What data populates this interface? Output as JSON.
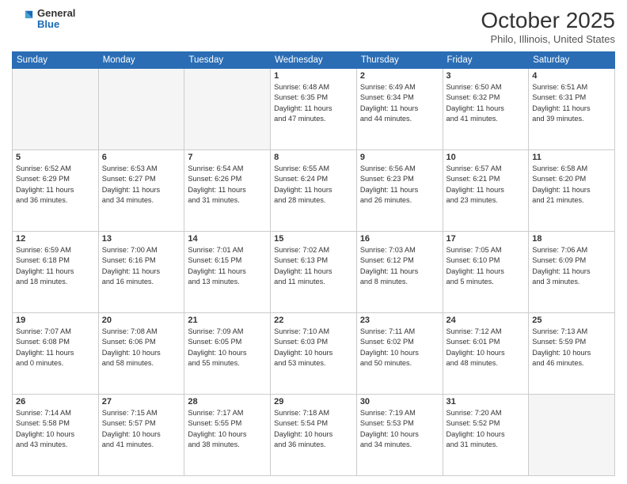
{
  "logo": {
    "general": "General",
    "blue": "Blue"
  },
  "header": {
    "month": "October 2025",
    "location": "Philo, Illinois, United States"
  },
  "weekdays": [
    "Sunday",
    "Monday",
    "Tuesday",
    "Wednesday",
    "Thursday",
    "Friday",
    "Saturday"
  ],
  "weeks": [
    [
      {
        "day": "",
        "info": ""
      },
      {
        "day": "",
        "info": ""
      },
      {
        "day": "",
        "info": ""
      },
      {
        "day": "1",
        "info": "Sunrise: 6:48 AM\nSunset: 6:35 PM\nDaylight: 11 hours\nand 47 minutes."
      },
      {
        "day": "2",
        "info": "Sunrise: 6:49 AM\nSunset: 6:34 PM\nDaylight: 11 hours\nand 44 minutes."
      },
      {
        "day": "3",
        "info": "Sunrise: 6:50 AM\nSunset: 6:32 PM\nDaylight: 11 hours\nand 41 minutes."
      },
      {
        "day": "4",
        "info": "Sunrise: 6:51 AM\nSunset: 6:31 PM\nDaylight: 11 hours\nand 39 minutes."
      }
    ],
    [
      {
        "day": "5",
        "info": "Sunrise: 6:52 AM\nSunset: 6:29 PM\nDaylight: 11 hours\nand 36 minutes."
      },
      {
        "day": "6",
        "info": "Sunrise: 6:53 AM\nSunset: 6:27 PM\nDaylight: 11 hours\nand 34 minutes."
      },
      {
        "day": "7",
        "info": "Sunrise: 6:54 AM\nSunset: 6:26 PM\nDaylight: 11 hours\nand 31 minutes."
      },
      {
        "day": "8",
        "info": "Sunrise: 6:55 AM\nSunset: 6:24 PM\nDaylight: 11 hours\nand 28 minutes."
      },
      {
        "day": "9",
        "info": "Sunrise: 6:56 AM\nSunset: 6:23 PM\nDaylight: 11 hours\nand 26 minutes."
      },
      {
        "day": "10",
        "info": "Sunrise: 6:57 AM\nSunset: 6:21 PM\nDaylight: 11 hours\nand 23 minutes."
      },
      {
        "day": "11",
        "info": "Sunrise: 6:58 AM\nSunset: 6:20 PM\nDaylight: 11 hours\nand 21 minutes."
      }
    ],
    [
      {
        "day": "12",
        "info": "Sunrise: 6:59 AM\nSunset: 6:18 PM\nDaylight: 11 hours\nand 18 minutes."
      },
      {
        "day": "13",
        "info": "Sunrise: 7:00 AM\nSunset: 6:16 PM\nDaylight: 11 hours\nand 16 minutes."
      },
      {
        "day": "14",
        "info": "Sunrise: 7:01 AM\nSunset: 6:15 PM\nDaylight: 11 hours\nand 13 minutes."
      },
      {
        "day": "15",
        "info": "Sunrise: 7:02 AM\nSunset: 6:13 PM\nDaylight: 11 hours\nand 11 minutes."
      },
      {
        "day": "16",
        "info": "Sunrise: 7:03 AM\nSunset: 6:12 PM\nDaylight: 11 hours\nand 8 minutes."
      },
      {
        "day": "17",
        "info": "Sunrise: 7:05 AM\nSunset: 6:10 PM\nDaylight: 11 hours\nand 5 minutes."
      },
      {
        "day": "18",
        "info": "Sunrise: 7:06 AM\nSunset: 6:09 PM\nDaylight: 11 hours\nand 3 minutes."
      }
    ],
    [
      {
        "day": "19",
        "info": "Sunrise: 7:07 AM\nSunset: 6:08 PM\nDaylight: 11 hours\nand 0 minutes."
      },
      {
        "day": "20",
        "info": "Sunrise: 7:08 AM\nSunset: 6:06 PM\nDaylight: 10 hours\nand 58 minutes."
      },
      {
        "day": "21",
        "info": "Sunrise: 7:09 AM\nSunset: 6:05 PM\nDaylight: 10 hours\nand 55 minutes."
      },
      {
        "day": "22",
        "info": "Sunrise: 7:10 AM\nSunset: 6:03 PM\nDaylight: 10 hours\nand 53 minutes."
      },
      {
        "day": "23",
        "info": "Sunrise: 7:11 AM\nSunset: 6:02 PM\nDaylight: 10 hours\nand 50 minutes."
      },
      {
        "day": "24",
        "info": "Sunrise: 7:12 AM\nSunset: 6:01 PM\nDaylight: 10 hours\nand 48 minutes."
      },
      {
        "day": "25",
        "info": "Sunrise: 7:13 AM\nSunset: 5:59 PM\nDaylight: 10 hours\nand 46 minutes."
      }
    ],
    [
      {
        "day": "26",
        "info": "Sunrise: 7:14 AM\nSunset: 5:58 PM\nDaylight: 10 hours\nand 43 minutes."
      },
      {
        "day": "27",
        "info": "Sunrise: 7:15 AM\nSunset: 5:57 PM\nDaylight: 10 hours\nand 41 minutes."
      },
      {
        "day": "28",
        "info": "Sunrise: 7:17 AM\nSunset: 5:55 PM\nDaylight: 10 hours\nand 38 minutes."
      },
      {
        "day": "29",
        "info": "Sunrise: 7:18 AM\nSunset: 5:54 PM\nDaylight: 10 hours\nand 36 minutes."
      },
      {
        "day": "30",
        "info": "Sunrise: 7:19 AM\nSunset: 5:53 PM\nDaylight: 10 hours\nand 34 minutes."
      },
      {
        "day": "31",
        "info": "Sunrise: 7:20 AM\nSunset: 5:52 PM\nDaylight: 10 hours\nand 31 minutes."
      },
      {
        "day": "",
        "info": ""
      }
    ]
  ]
}
